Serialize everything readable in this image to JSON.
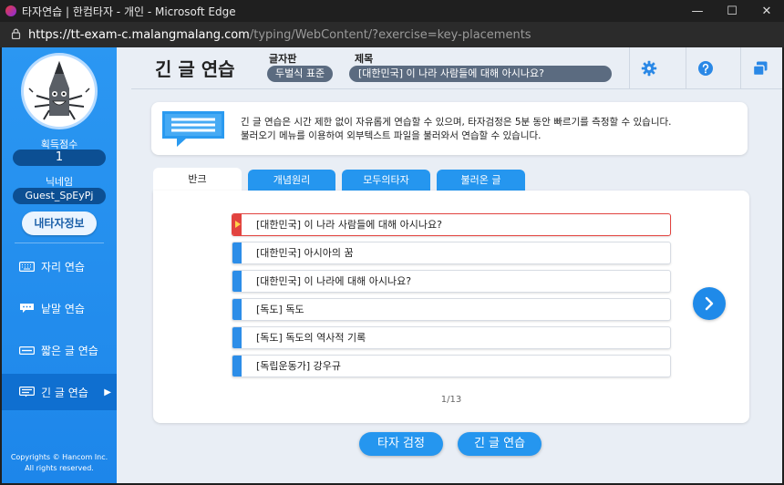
{
  "window": {
    "title": "타자연습 | 한컴타자 - 개인 - Microsoft Edge",
    "url_host": "https://tt-exam-c.malangmalang.com",
    "url_path": "/typing/WebContent/?exercise=key-placements"
  },
  "sidebar": {
    "score_label": "획득점수",
    "score_value": "1",
    "nickname_label": "닉네임",
    "nickname_value": "Guest_SpEyPj",
    "myinfo_button": "내타자정보",
    "nav": [
      {
        "label": "자리 연습",
        "icon": "keyboard-icon"
      },
      {
        "label": "낱말 연습",
        "icon": "speech-bubble-icon"
      },
      {
        "label": "짧은 글 연습",
        "icon": "short-text-icon"
      },
      {
        "label": "긴 글 연습",
        "icon": "long-text-icon",
        "active": true
      }
    ],
    "copyright_line1": "Copyrights © Hancom Inc.",
    "copyright_line2": "All rights reserved."
  },
  "header": {
    "title": "긴 글 연습",
    "keyboard_label": "글자판",
    "keyboard_value": "두벌식 표준",
    "text_title_label": "제목",
    "text_title_value": "[대한민국] 이 나라 사람들에 대해 아시나요?",
    "icons": [
      "gear-icon",
      "help-icon",
      "window-icon"
    ]
  },
  "info": {
    "line1": "긴 글 연습은 시간 제한 없이 자유롭게 연습할 수 있으며, 타자검정은 5분 동안 빠르기를 측정할 수 있습니다.",
    "line2": "불러오기 메뉴를 이용하여 외부텍스트 파일을 불러와서 연습할 수 있습니다."
  },
  "tabs": [
    {
      "label": "반크",
      "active": true
    },
    {
      "label": "개념원리"
    },
    {
      "label": "모두의타자"
    },
    {
      "label": "불러온 글"
    }
  ],
  "list": {
    "items": [
      {
        "label": "[대한민국] 이 나라 사람들에 대해 아시나요?",
        "selected": true
      },
      {
        "label": "[대한민국] 아시아의 꿈"
      },
      {
        "label": "[대한민국] 이 나라에 대해 아시나요?"
      },
      {
        "label": "[독도] 독도"
      },
      {
        "label": "[독도] 독도의 역사적 기록"
      },
      {
        "label": "[독립운동가] 강우규"
      }
    ],
    "pager": "1/13"
  },
  "buttons": {
    "typing_test": "타자 검정",
    "long_practice": "긴 글 연습"
  },
  "colors": {
    "sidebar": "#1d86ea",
    "accent": "#2596ef",
    "selected": "#e2433f"
  }
}
